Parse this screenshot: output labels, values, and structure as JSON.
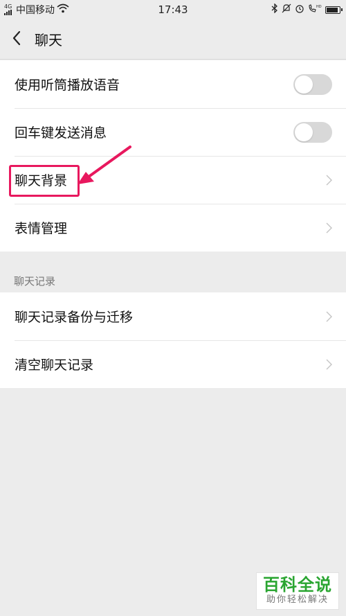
{
  "status_bar": {
    "network_type": "4G",
    "carrier": "中国移动",
    "time": "17:43",
    "icons": [
      "wifi-icon",
      "bluetooth-icon",
      "mute-icon",
      "alarm-icon",
      "call-hd-icon",
      "battery-icon"
    ],
    "battery_level": 0.8
  },
  "nav": {
    "title": "聊天",
    "back_icon": "chevron-left-icon"
  },
  "settings": {
    "group1": [
      {
        "label": "使用听筒播放语音",
        "control": "toggle",
        "on": false
      },
      {
        "label": "回车键发送消息",
        "control": "toggle",
        "on": false
      },
      {
        "label": "聊天背景",
        "control": "chevron"
      },
      {
        "label": "表情管理",
        "control": "chevron"
      }
    ],
    "section_header": "聊天记录",
    "group2": [
      {
        "label": "聊天记录备份与迁移",
        "control": "chevron"
      },
      {
        "label": "清空聊天记录",
        "control": "chevron"
      }
    ]
  },
  "annotation": {
    "color": "#e8185e"
  },
  "watermark": {
    "title": "百科全说",
    "subtitle": "助你轻松解决"
  },
  "colors": {
    "background": "#ececec",
    "card": "#ffffff",
    "toggle_off": "#d8d8d8",
    "accent_watermark": "#2aa531"
  }
}
